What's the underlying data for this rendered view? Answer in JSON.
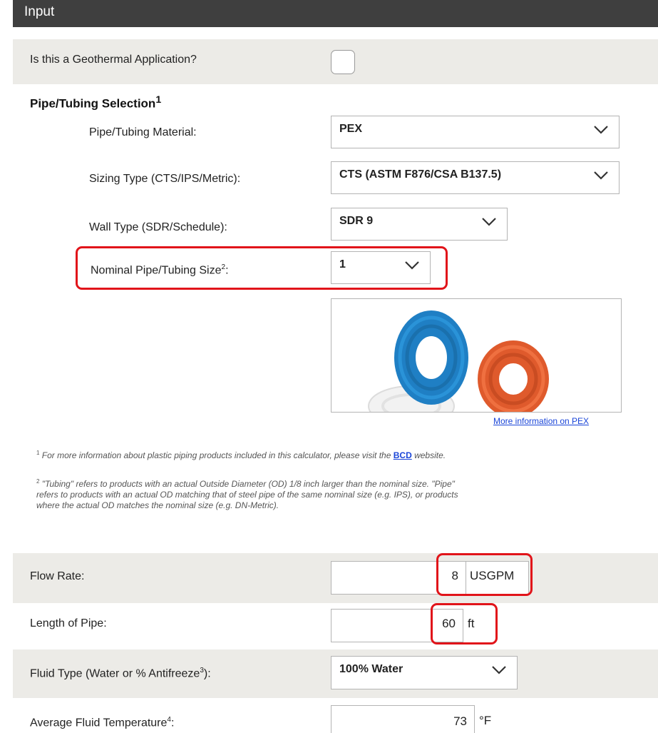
{
  "header": {
    "title": "Input"
  },
  "geothermal": {
    "label": "Is this a Geothermal Application?"
  },
  "pipe_selection": {
    "title": "Pipe/Tubing Selection",
    "title_sup": "1",
    "material": {
      "label": "Pipe/Tubing Material:",
      "value": "PEX"
    },
    "sizing_type": {
      "label": "Sizing Type (CTS/IPS/Metric):",
      "value": "CTS (ASTM F876/CSA B137.5)"
    },
    "wall_type": {
      "label": "Wall Type (SDR/Schedule):",
      "value": "SDR 9"
    },
    "nominal_size": {
      "label": "Nominal Pipe/Tubing Size",
      "label_sup": "2",
      "label_suffix": ":",
      "value": "1"
    },
    "more_info_link": "More information on PEX"
  },
  "footnotes": {
    "note1": {
      "num": "1",
      "text_before": "For more information about plastic piping products included in this calculator, please visit the ",
      "link": "BCD",
      "text_after": " website."
    },
    "note2": {
      "num": "2",
      "line1": "\"Tubing\" refers to products with an actual Outside Diameter (OD) 1/8 inch larger than the nominal size. \"Pipe\"",
      "line2": "refers to products with an actual OD matching that of steel pipe of the same nominal size (e.g. IPS), or products",
      "line3": "where the actual OD matches the nominal size (e.g. DN-Metric)."
    }
  },
  "flow_rate": {
    "label": "Flow Rate:",
    "value": "8",
    "unit": "USGPM"
  },
  "length": {
    "label": "Length of Pipe:",
    "value": "60",
    "unit": "ft"
  },
  "fluid_type": {
    "label": "Fluid Type (Water or % Antifreeze",
    "label_sup": "3",
    "label_suffix": "):",
    "value": "100% Water"
  },
  "avg_temp": {
    "label": "Average Fluid Temperature",
    "label_sup": "4",
    "label_suffix": ":",
    "value": "73",
    "unit": "°F"
  },
  "icons": {
    "dropdown": "chevron-down-icon",
    "image": "pex-pipe-coils-image"
  },
  "colors": {
    "header_bg": "#3f3f3f",
    "band_bg": "#ecebe7",
    "highlight": "#e1141a",
    "link": "#1a45d8"
  }
}
